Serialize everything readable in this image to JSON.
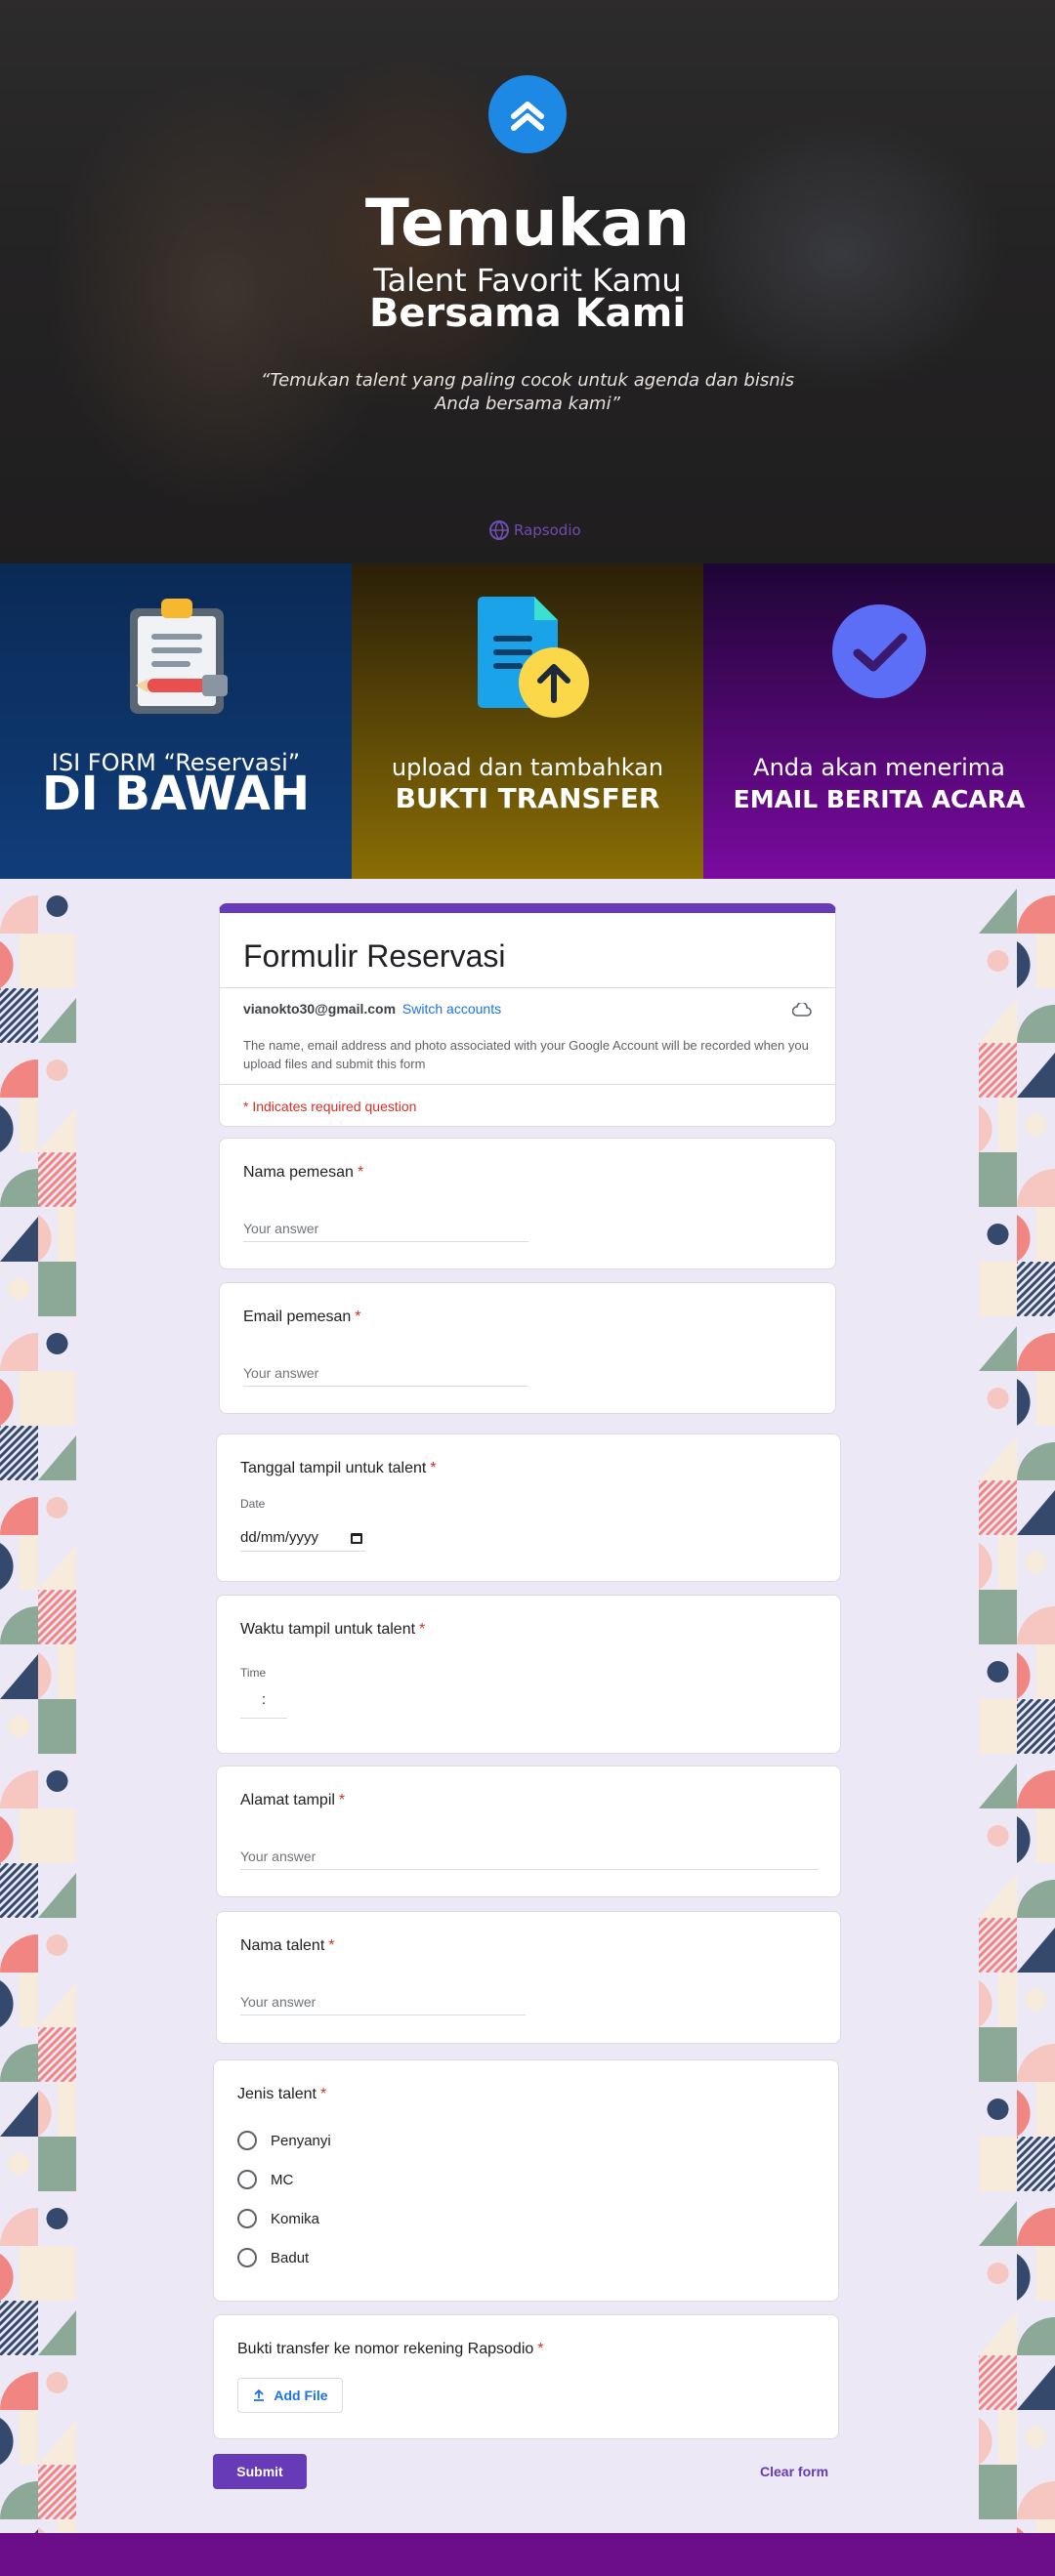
{
  "hero": {
    "title": "Temukan",
    "subtitle": "Talent Favorit Kamu",
    "subtitle_bold": "Bersama Kami",
    "quote": "“Temukan talent yang paling cocok untuk agenda dan bisnis Anda bersama kami”",
    "brand": "Rapsodio",
    "logo_icon": "double-chevron-up-icon",
    "accent_color": "#1e88e5"
  },
  "steps": [
    {
      "icon": "clipboard-icon",
      "line1": "ISI FORM “Reservasi”",
      "line2": "DI BAWAH",
      "color": "#103d7a"
    },
    {
      "icon": "upload-document-icon",
      "line1": "upload dan tambahkan",
      "line2": "BUKTI TRANSFER",
      "color": "#8a6e05"
    },
    {
      "icon": "check-circle-icon",
      "line1": "Anda akan menerima",
      "line2": "EMAIL BERITA ACARA",
      "color": "#7a0aa0"
    }
  ],
  "form": {
    "title": "Formulir Reservasi",
    "account_email": "vianokto30@gmail.com",
    "switch_accounts": "Switch accounts",
    "notice": "The name, email address and photo associated with your Google Account will be recorded when you upload files and submit this form",
    "required_note": "* Indicates required question",
    "theme_color": "#673ab7",
    "questions": {
      "nama_pemesan": {
        "label": "Nama pemesan",
        "placeholder": "Your answer"
      },
      "email_pemesan": {
        "label": "Email pemesan",
        "placeholder": "Your answer"
      },
      "tanggal": {
        "label": "Tanggal tampil untuk talent",
        "sublabel": "Date",
        "value": "dd/mm/yyyy"
      },
      "waktu": {
        "label": "Waktu tampil untuk talent",
        "sublabel": "Time",
        "value": ":"
      },
      "alamat": {
        "label": "Alamat tampil",
        "placeholder": "Your answer"
      },
      "nama_talent": {
        "label": "Nama talent",
        "placeholder": "Your answer"
      },
      "jenis_talent": {
        "label": "Jenis talent",
        "options": [
          "Penyanyi",
          "MC",
          "Komika",
          "Badut"
        ]
      },
      "bukti": {
        "label": "Bukti transfer ke nomor rekening Rapsodio",
        "button": "Add File"
      }
    },
    "required_mark": "*",
    "submit": "Submit",
    "clear": "Clear form"
  }
}
